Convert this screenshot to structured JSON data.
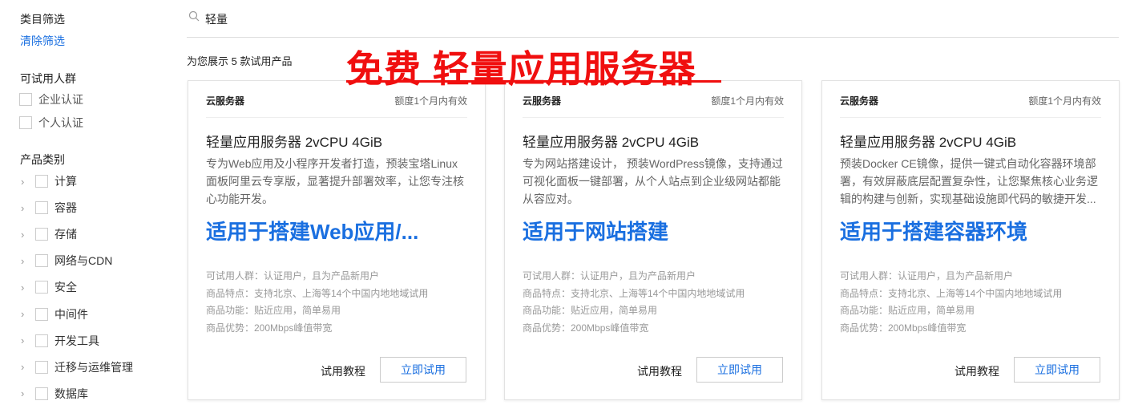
{
  "sidebar": {
    "title": "类目筛选",
    "clear": "清除筛选",
    "audience_title": "可试用人群",
    "audience": [
      "企业认证",
      "个人认证"
    ],
    "category_title": "产品类别",
    "categories": [
      "计算",
      "容器",
      "存储",
      "网络与CDN",
      "安全",
      "中间件",
      "开发工具",
      "迁移与运维管理",
      "数据库"
    ]
  },
  "search": {
    "value": "轻量"
  },
  "result_count": "为您展示 5 款试用产品",
  "promo": {
    "text": "免费 轻量应用服务器",
    "color": "#f00f0f"
  },
  "cards": [
    {
      "category": "云服务器",
      "validity": "额度1个月内有效",
      "title": "轻量应用服务器 2vCPU 4GiB",
      "desc": "专为Web应用及小程序开发者打造，预装宝塔Linux面板阿里云专享版，显著提升部署效率，让您专注核心功能开发。",
      "highlight": "适用于搭建Web应用/...",
      "features": [
        "可试用人群：认证用户，且为产品新用户",
        "商品特点：支持北京、上海等14个中国内地地域试用",
        "商品功能：贴近应用，简单易用",
        "商品优势：200Mbps峰值带宽"
      ],
      "tutorial": "试用教程",
      "try": "立即试用"
    },
    {
      "category": "云服务器",
      "validity": "额度1个月内有效",
      "title": "轻量应用服务器 2vCPU 4GiB",
      "desc": "专为网站搭建设计， 预装WordPress镜像，支持通过可视化面板一键部署，从个人站点到企业级网站都能从容应对。",
      "highlight": "适用于网站搭建",
      "features": [
        "可试用人群：认证用户，且为产品新用户",
        "商品特点：支持北京、上海等14个中国内地地域试用",
        "商品功能：贴近应用，简单易用",
        "商品优势：200Mbps峰值带宽"
      ],
      "tutorial": "试用教程",
      "try": "立即试用"
    },
    {
      "category": "云服务器",
      "validity": "额度1个月内有效",
      "title": "轻量应用服务器 2vCPU 4GiB",
      "desc": "预装Docker CE镜像，提供一键式自动化容器环境部署，有效屏蔽底层配置复杂性，让您聚焦核心业务逻辑的构建与创新，实现基础设施即代码的敏捷开发...",
      "highlight": "适用于搭建容器环境",
      "features": [
        "可试用人群：认证用户，且为产品新用户",
        "商品特点：支持北京、上海等14个中国内地地域试用",
        "商品功能：贴近应用，简单易用",
        "商品优势：200Mbps峰值带宽"
      ],
      "tutorial": "试用教程",
      "try": "立即试用"
    }
  ]
}
